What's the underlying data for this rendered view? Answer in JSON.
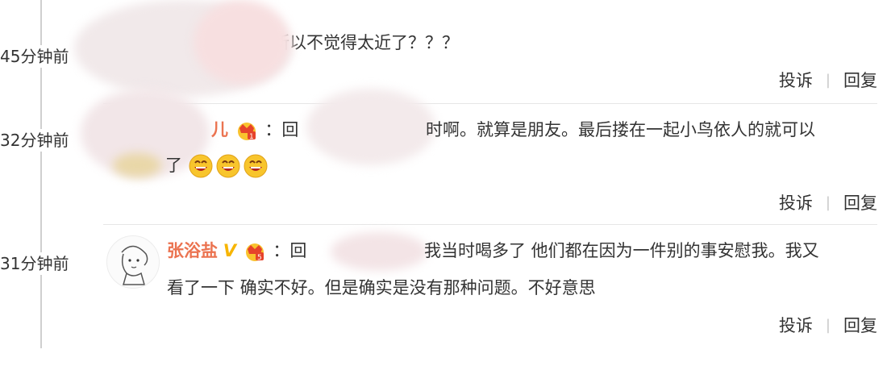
{
  "timeline": [
    {
      "time": "45分钟前"
    },
    {
      "time": "32分钟前"
    },
    {
      "time": "31分钟前"
    }
  ],
  "comments": [
    {
      "text": "所以不觉得太近了？？？",
      "report": "投诉",
      "reply": "回复"
    },
    {
      "user_tail": "儿",
      "colon_reply": "：回",
      "text_main": "时啊。就算是朋友。最后搂在一起小鸟依人的就可以",
      "text_cont": "了",
      "report": "投诉",
      "reply": "回复"
    },
    {
      "username": "张浴盐",
      "vip_mark": "V",
      "colon_reply": "：回",
      "text_main": "我当时喝多了 他们都在因为一件别的事安慰我。我又",
      "text_cont": "看了一下 确实不好。但是确实是没有那种问题。不好意思",
      "report": "投诉",
      "reply": "回复"
    }
  ],
  "icons": {
    "crown": "crown-badge-icon",
    "emoji": "grinning-face-icon",
    "vip": "verified-v-icon"
  },
  "colors": {
    "username": "#eb7350",
    "vip": "#f7b500",
    "timeline": "#cfcfcf"
  }
}
